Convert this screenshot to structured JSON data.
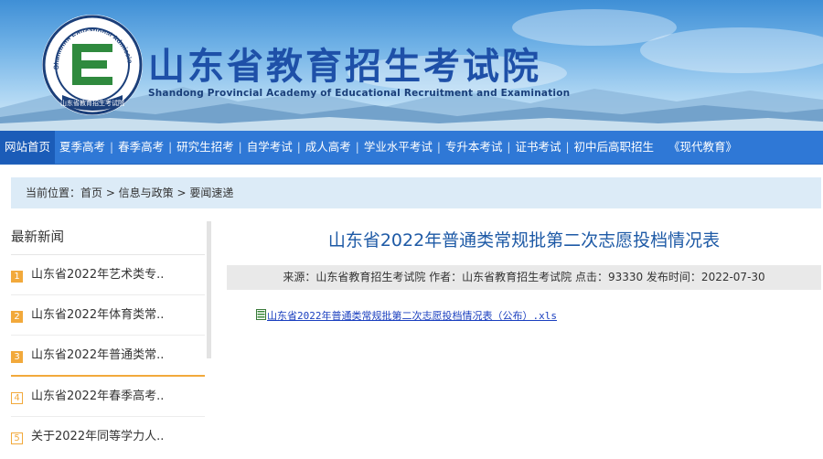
{
  "header": {
    "title": "山东省教育招生考试院",
    "subtitle": "Shandong Provincial Academy of Educational Recruitment and Examination",
    "logo_ring_text": "Shandong Educational Admission & Examinations",
    "logo_bottom_text": "山东省教育招生考试院",
    "logo_letter": "E"
  },
  "nav": {
    "items": [
      "网站首页",
      "夏季高考",
      "春季高考",
      "研究生招考",
      "自学考试",
      "成人高考",
      "学业水平考试",
      "专升本考试",
      "证书考试",
      "初中后高职招生",
      "《现代教育》"
    ],
    "separator": "|"
  },
  "breadcrumb": {
    "text": "当前位置：首页 > 信息与政策 > 要闻速递"
  },
  "sidebar": {
    "heading": "最新新闻",
    "items": [
      {
        "num": "1",
        "text": "山东省2022年艺术类专.."
      },
      {
        "num": "2",
        "text": "山东省2022年体育类常.."
      },
      {
        "num": "3",
        "text": "山东省2022年普通类常.."
      },
      {
        "num": "4",
        "text": "山东省2022年春季高考.."
      },
      {
        "num": "5",
        "text": "关于2022年同等学力人.."
      }
    ]
  },
  "article": {
    "title": "山东省2022年普通类常规批第二次志愿投档情况表",
    "meta": "来源：山东省教育招生考试院 作者：山东省教育招生考试院 点击：93330 发布时间：2022-07-30",
    "attachment": "山东省2022年普通类常规批第二次志愿投档情况表（公布）.xls"
  },
  "colors": {
    "nav_bg": "#2f78d6",
    "title_blue": "#1e50a8",
    "number_orange": "#f2a93b",
    "crumb_bg": "#dcebf7"
  },
  "icons": {
    "attachment": "excel-file-icon",
    "logo": "academy-logo-icon"
  }
}
